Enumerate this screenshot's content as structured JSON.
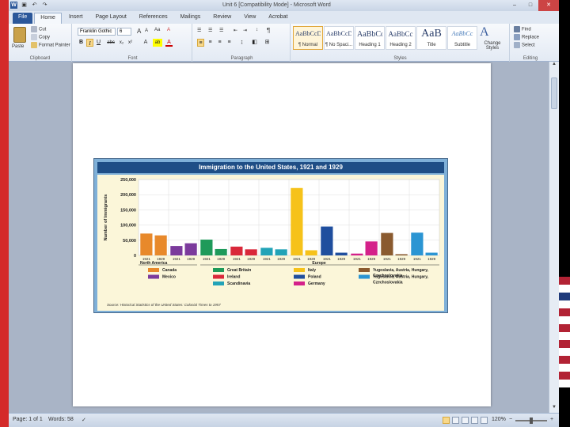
{
  "window": {
    "title": "Unit 6 [Compatibility Mode] - Microsoft Word",
    "logo": "W",
    "quick_access": [
      "save-icon",
      "undo-icon",
      "redo-icon"
    ],
    "controls": {
      "minimize": "–",
      "maximize": "□",
      "close": "✕"
    }
  },
  "ribbon": {
    "tabs": [
      "File",
      "Home",
      "Insert",
      "Page Layout",
      "References",
      "Mailings",
      "Review",
      "View",
      "Acrobat"
    ],
    "active_tab": "Home",
    "clipboard": {
      "paste": "Paste",
      "cut": "Cut",
      "copy": "Copy",
      "format_painter": "Format Painter",
      "label": "Clipboard"
    },
    "font": {
      "family": "Franklin Gothic",
      "size": "6",
      "label": "Font",
      "bold": "B",
      "italic": "I",
      "underline": "U",
      "strike": "abc",
      "subscript": "x₂",
      "superscript": "x²",
      "grow": "A",
      "shrink": "A",
      "change_case": "Aa",
      "clear": "A",
      "highlight": "ab",
      "color": "A"
    },
    "paragraph": {
      "label": "Paragraph",
      "pilcrow": "¶"
    },
    "styles": {
      "label": "Styles",
      "items": [
        {
          "sample": "AaBbCcDc",
          "name": "¶ Normal",
          "active": true
        },
        {
          "sample": "AaBbCcDc",
          "name": "¶ No Spaci...",
          "active": false
        },
        {
          "sample": "AaBbCc",
          "name": "Heading 1",
          "active": false
        },
        {
          "sample": "AaBbCc",
          "name": "Heading 2",
          "active": false
        },
        {
          "sample": "AaB",
          "name": "Title",
          "active": false
        },
        {
          "sample": "AaBbCc",
          "name": "Subtitle",
          "active": false
        }
      ],
      "change_styles": "Change Styles"
    },
    "editing": {
      "label": "Editing",
      "find": "Find",
      "replace": "Replace",
      "select": "Select"
    }
  },
  "figure": {
    "title": "Immigration to the United States, 1921 and 1929",
    "source": "Source: Historical Statistics of the United States: Colonial Times to 1957"
  },
  "chart_data": {
    "type": "bar",
    "title": "Immigration to the United States, 1921 and 1929",
    "ylabel": "Number of Immigrants",
    "ylim": [
      0,
      250000
    ],
    "yticks": [
      "250,000",
      "200,000",
      "150,000",
      "100,000",
      "50,000",
      "0"
    ],
    "year_labels": [
      "1921",
      "1929"
    ],
    "groups": [
      {
        "name": "Canada",
        "region": "North America",
        "color": "#e8892b",
        "values": [
          72000,
          66000
        ]
      },
      {
        "name": "Mexico",
        "region": "North America",
        "color": "#7b3a9c",
        "values": [
          31000,
          40000
        ]
      },
      {
        "name": "Great Britain",
        "region": "Europe",
        "color": "#1e9a5a",
        "values": [
          52000,
          21000
        ]
      },
      {
        "name": "Ireland",
        "region": "Europe",
        "color": "#d9283a",
        "values": [
          29000,
          20000
        ]
      },
      {
        "name": "Scandinavia",
        "region": "Europe",
        "color": "#22a3b7",
        "values": [
          25000,
          20000
        ]
      },
      {
        "name": "Italy",
        "region": "Europe",
        "color": "#f6c21a",
        "values": [
          222000,
          17000
        ]
      },
      {
        "name": "Poland",
        "region": "Europe",
        "color": "#1f4e9e",
        "values": [
          95000,
          9000
        ]
      },
      {
        "name": "Germany",
        "region": "Europe",
        "color": "#d4218a",
        "values": [
          6000,
          46000
        ]
      },
      {
        "name": "Portugal, Spain, Greece",
        "region": "Europe",
        "color": "#8a5a2f",
        "values": [
          74000,
          4000
        ]
      },
      {
        "name": "Yugoslavia, Austria, Hungary, Czechoslovakia",
        "region": "Europe",
        "color": "#2b95d3",
        "values": [
          75000,
          9000
        ]
      }
    ],
    "regions": [
      "North America",
      "Europe"
    ],
    "grid": true
  },
  "status": {
    "page": "Page: 1 of 1",
    "words": "Words: 58",
    "zoom": "120%"
  }
}
